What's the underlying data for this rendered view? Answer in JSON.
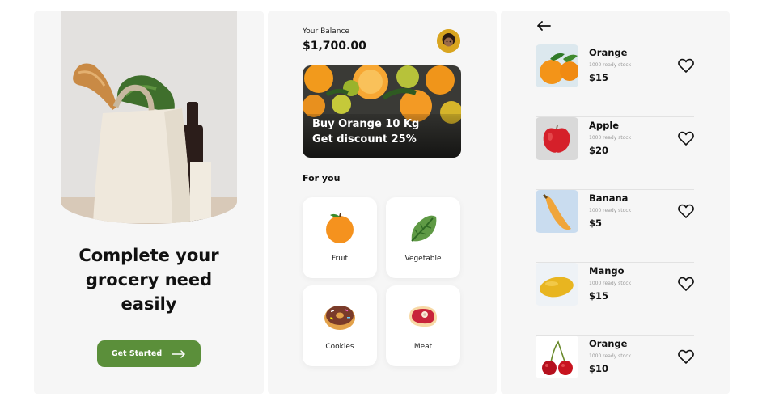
{
  "onboarding": {
    "headline_lines": [
      "Complete your",
      "grocery need",
      "easily"
    ],
    "cta_label": "Get Started",
    "cta_color": "#5b8f3a"
  },
  "home": {
    "balance_label": "Your Balance",
    "balance_amount": "$1,700.00",
    "banner": {
      "line1": "Buy Orange 10 Kg",
      "line2": "Get discount 25%"
    },
    "section_title": "For you",
    "categories": [
      {
        "label": "Fruit",
        "icon": "orange-icon"
      },
      {
        "label": "Vegetable",
        "icon": "lettuce-icon"
      },
      {
        "label": "Cookies",
        "icon": "donut-icon"
      },
      {
        "label": "Meat",
        "icon": "meat-icon"
      }
    ]
  },
  "products": {
    "items": [
      {
        "name": "Orange",
        "stock": "1000 ready stock",
        "price": "$15",
        "image": "orange"
      },
      {
        "name": "Apple",
        "stock": "1000 ready stock",
        "price": "$20",
        "image": "apple"
      },
      {
        "name": "Banana",
        "stock": "1000 ready stock",
        "price": "$5",
        "image": "banana"
      },
      {
        "name": "Mango",
        "stock": "1000 ready stock",
        "price": "$15",
        "image": "mango"
      },
      {
        "name": "Orange",
        "stock": "1000 ready stock",
        "price": "$10",
        "image": "cherry"
      }
    ]
  },
  "colors": {
    "panel_bg": "#f6f6f6",
    "accent_green": "#5b8f3a",
    "divider": "#e2e2e2"
  }
}
